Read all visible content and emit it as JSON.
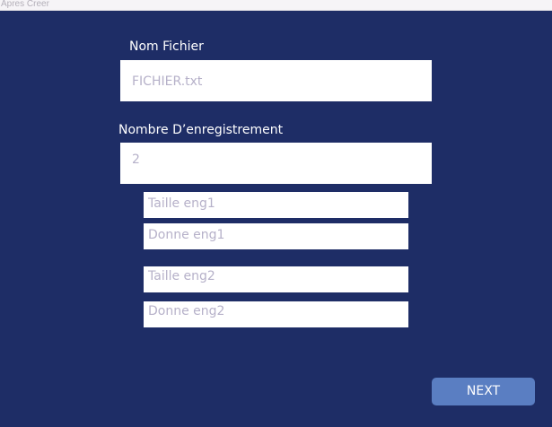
{
  "window": {
    "title": "Apres Creer"
  },
  "form": {
    "nom_fichier_label": "Nom Fichier",
    "nom_fichier_value": "FICHIER.txt",
    "nombre_label": "Nombre D’enregistrement",
    "nombre_value": "2",
    "records": [
      {
        "taille": "Taille eng1",
        "donne": "Donne eng1"
      },
      {
        "taille": "Taille eng2",
        "donne": "Donne eng2"
      }
    ]
  },
  "actions": {
    "next_label": "NEXT"
  },
  "colors": {
    "background": "#1e2d66",
    "button": "#5a7ec2",
    "field_text": "#b6b1c9"
  }
}
